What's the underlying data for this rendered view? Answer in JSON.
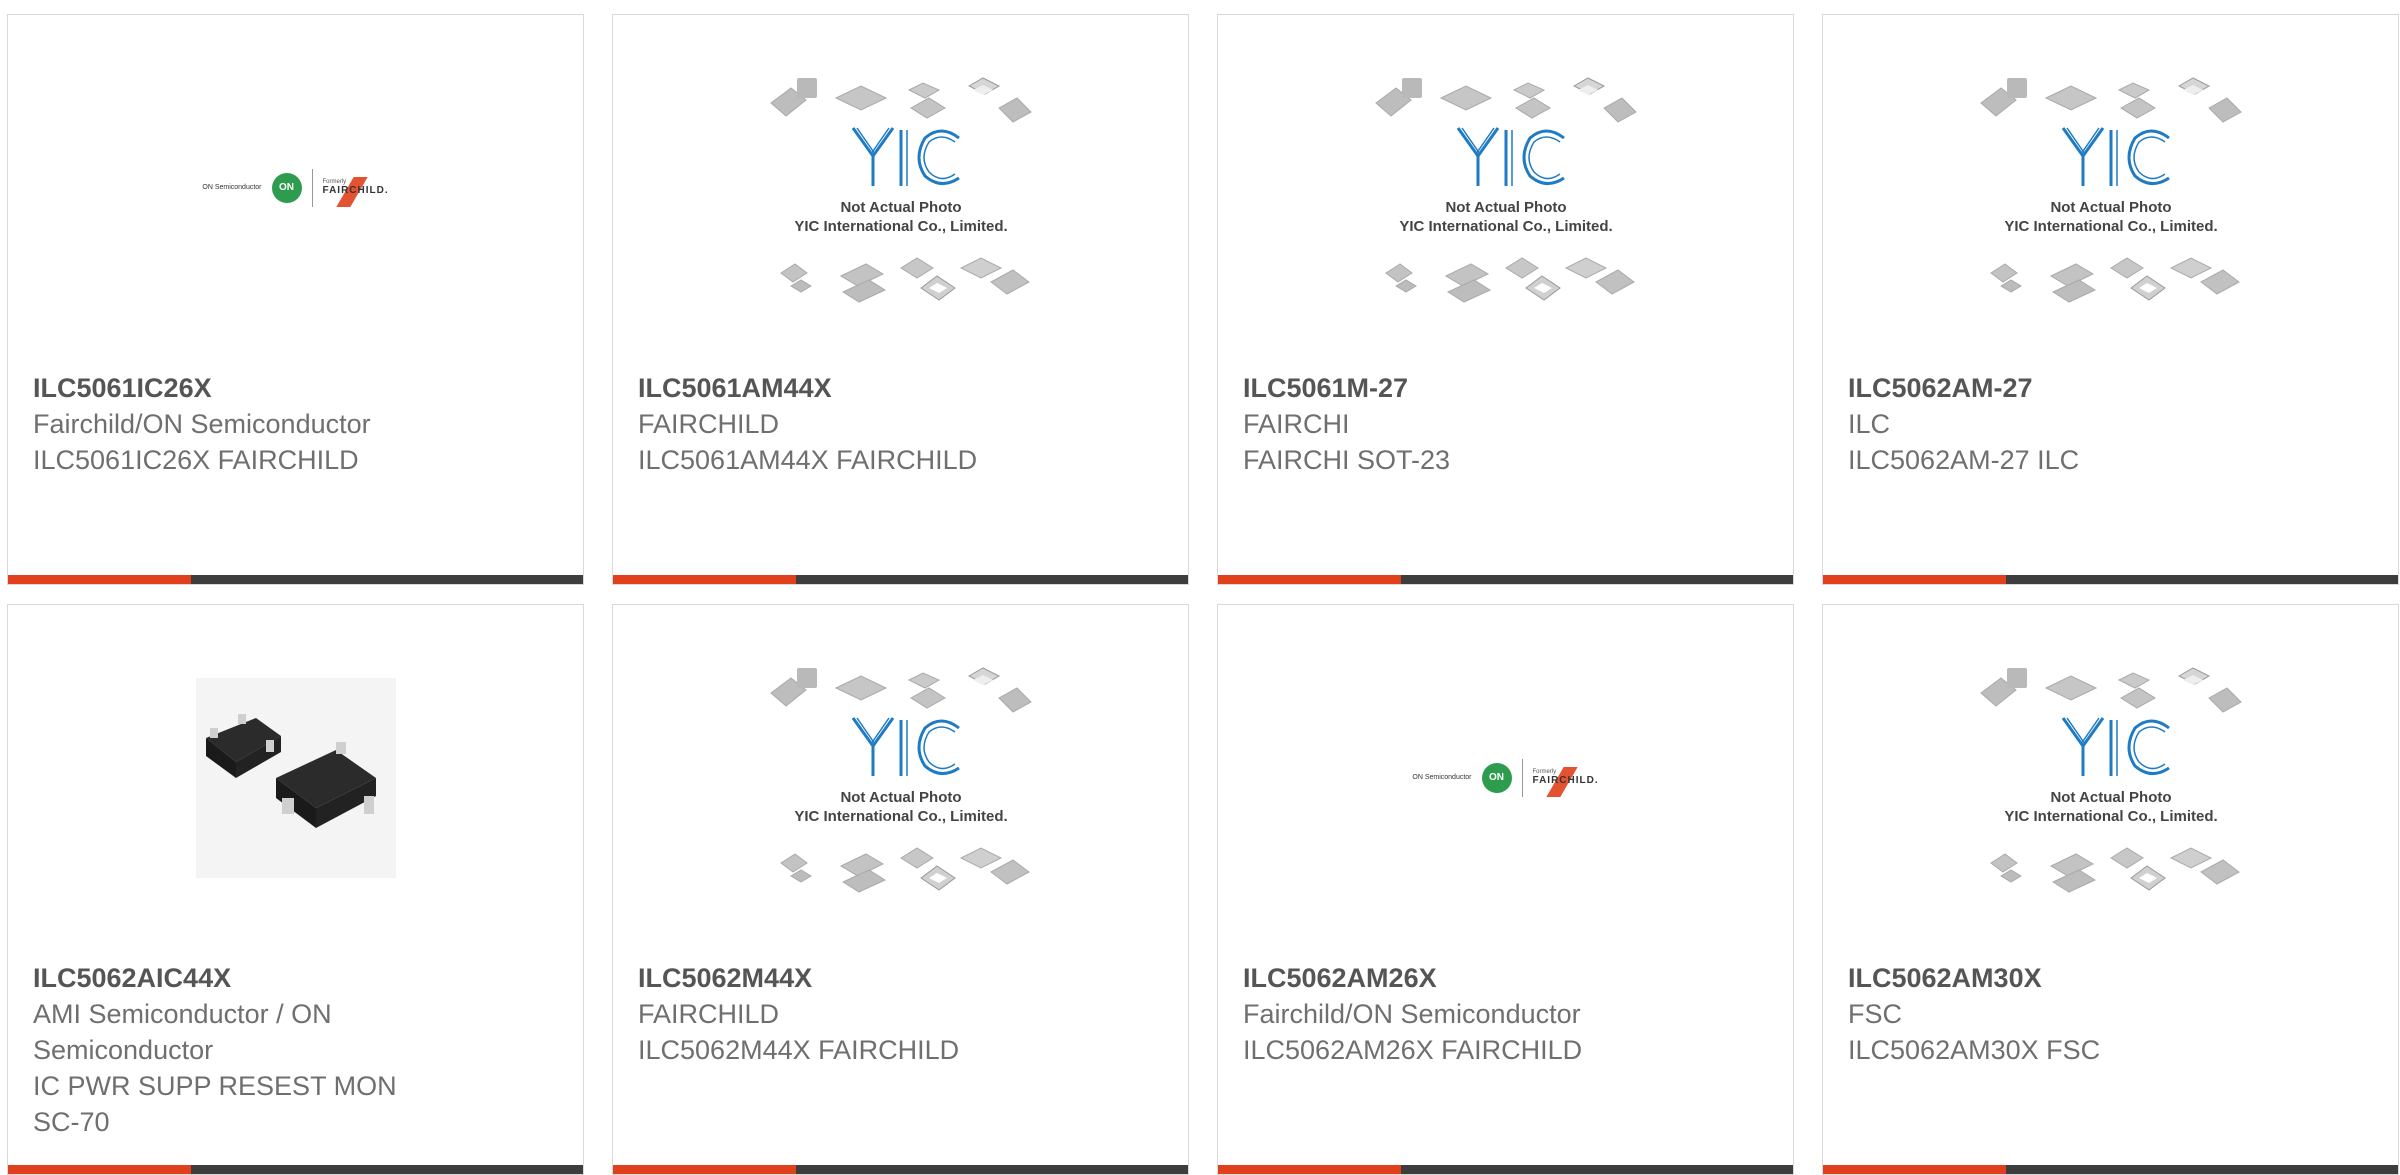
{
  "cards": [
    {
      "image": "manufacturer-logo",
      "part": "ILC5061IC26X",
      "lines": [
        "Fairchild/ON Semiconductor",
        "ILC5061IC26X FAIRCHILD"
      ]
    },
    {
      "image": "placeholder-photo",
      "part": "ILC5061AM44X",
      "lines": [
        "FAIRCHILD",
        "ILC5061AM44X FAIRCHILD"
      ]
    },
    {
      "image": "placeholder-photo",
      "part": "ILC5061M-27",
      "lines": [
        "FAIRCHI",
        "FAIRCHI SOT-23"
      ]
    },
    {
      "image": "placeholder-photo",
      "part": "ILC5062AM-27",
      "lines": [
        "ILC",
        "ILC5062AM-27 ILC"
      ]
    },
    {
      "image": "product-photo",
      "part": "ILC5062AIC44X",
      "lines": [
        "AMI Semiconductor / ON",
        "Semiconductor",
        "IC PWR SUPP RESEST MON",
        "SC-70"
      ]
    },
    {
      "image": "placeholder-photo",
      "part": "ILC5062M44X",
      "lines": [
        "FAIRCHILD",
        "ILC5062M44X FAIRCHILD"
      ]
    },
    {
      "image": "manufacturer-logo",
      "part": "ILC5062AM26X",
      "lines": [
        "Fairchild/ON Semiconductor",
        "ILC5062AM26X FAIRCHILD"
      ]
    },
    {
      "image": "placeholder-photo",
      "part": "ILC5062AM30X",
      "lines": [
        "FSC",
        "ILC5062AM30X FSC"
      ]
    }
  ],
  "placeholder": {
    "brand": "YIC",
    "caption_1": "Not Actual Photo",
    "caption_2": "YIC International Co., Limited."
  },
  "logo": {
    "on_text": "ON Semiconductor",
    "on_mark": "ON",
    "formerly": "Formerly",
    "fairchild": "FAIRCHILD."
  },
  "colors": {
    "accent": "#e0401b",
    "bar": "#3d3d3d",
    "yic_blue": "#1f7bc4",
    "on_green": "#2e9c4f"
  }
}
